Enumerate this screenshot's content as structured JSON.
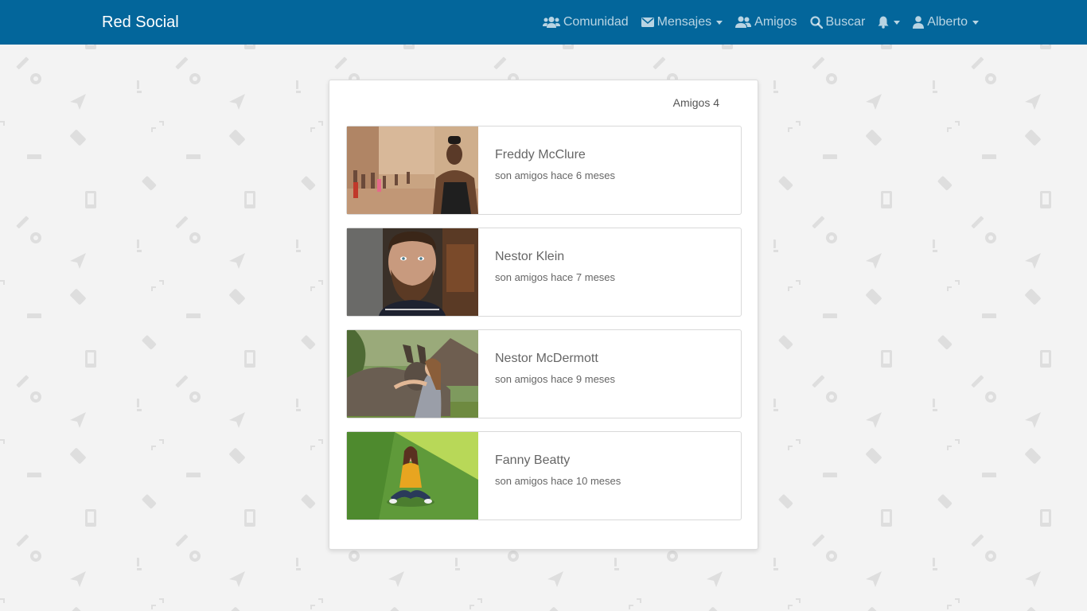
{
  "navbar": {
    "brand": "Red Social",
    "items": [
      {
        "label": "Comunidad",
        "icon": "users-icon",
        "dropdown": false
      },
      {
        "label": "Mensajes",
        "icon": "envelope-icon",
        "dropdown": true
      },
      {
        "label": "Amigos",
        "icon": "user-friends-icon",
        "dropdown": false
      },
      {
        "label": "Buscar",
        "icon": "search-icon",
        "dropdown": false
      },
      {
        "label": "",
        "icon": "bell-icon",
        "dropdown": true
      },
      {
        "label": "Alberto",
        "icon": "user-icon",
        "dropdown": true
      }
    ]
  },
  "friends_card": {
    "header": "Amigos 4",
    "friends": [
      {
        "name": "Freddy McClure",
        "since": "son amigos hace 6 meses"
      },
      {
        "name": "Nestor Klein",
        "since": "son amigos hace 7 meses"
      },
      {
        "name": "Nestor McDermott",
        "since": "son amigos hace 9 meses"
      },
      {
        "name": "Fanny Beatty",
        "since": "son amigos hace 10 meses"
      }
    ]
  },
  "colors": {
    "navbar": "#03669b",
    "background": "#f3f3f3",
    "card": "#ffffff"
  }
}
